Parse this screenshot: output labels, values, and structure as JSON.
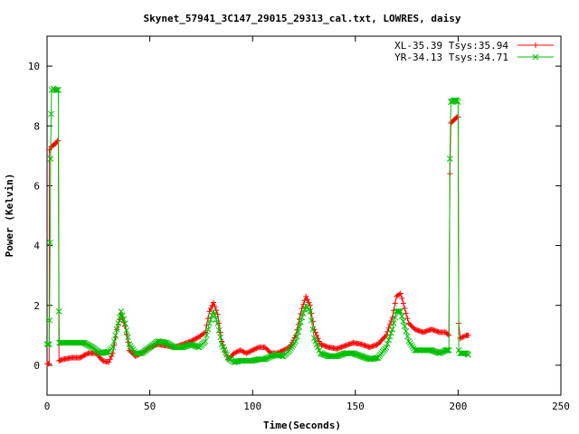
{
  "chart_data": {
    "type": "line",
    "title": "Skynet_57941_3C147_29015_29313_cal.txt, LOWRES, daisy",
    "xlabel": "Time(Seconds)",
    "ylabel": "Power (Kelvin)",
    "xlim": [
      0,
      250
    ],
    "ylim": [
      -1,
      11
    ],
    "xticks": [
      0,
      50,
      100,
      150,
      200,
      250
    ],
    "yticks": [
      0,
      2,
      4,
      6,
      8,
      10
    ],
    "grid": false,
    "legend_position": "top-right",
    "series": [
      {
        "name": "XL-35.39 Tsys:35.94",
        "color": "#ff0000",
        "marker": "plus",
        "points": [
          [
            0,
            0.05
          ],
          [
            1,
            0.05
          ],
          [
            1.2,
            7.2
          ],
          [
            2,
            7.3
          ],
          [
            3,
            7.35
          ],
          [
            4,
            7.4
          ],
          [
            5,
            7.5
          ],
          [
            5.5,
            7.5
          ],
          [
            5.8,
            0.15
          ],
          [
            8,
            0.2
          ],
          [
            12,
            0.25
          ],
          [
            16,
            0.25
          ],
          [
            20,
            0.4
          ],
          [
            24,
            0.4
          ],
          [
            27,
            0.15
          ],
          [
            30,
            0.1
          ],
          [
            32,
            0.4
          ],
          [
            34,
            1.2
          ],
          [
            36,
            1.7
          ],
          [
            38,
            1.3
          ],
          [
            40,
            0.5
          ],
          [
            43,
            0.3
          ],
          [
            46,
            0.4
          ],
          [
            50,
            0.6
          ],
          [
            54,
            0.7
          ],
          [
            58,
            0.65
          ],
          [
            62,
            0.6
          ],
          [
            66,
            0.7
          ],
          [
            70,
            0.8
          ],
          [
            74,
            0.95
          ],
          [
            77,
            1.1
          ],
          [
            79,
            1.8
          ],
          [
            81,
            2.1
          ],
          [
            83,
            1.7
          ],
          [
            85,
            0.8
          ],
          [
            88,
            0.2
          ],
          [
            91,
            0.4
          ],
          [
            94,
            0.5
          ],
          [
            97,
            0.4
          ],
          [
            100,
            0.5
          ],
          [
            103,
            0.6
          ],
          [
            106,
            0.6
          ],
          [
            109,
            0.4
          ],
          [
            112,
            0.4
          ],
          [
            115,
            0.5
          ],
          [
            118,
            0.6
          ],
          [
            121,
            1.0
          ],
          [
            124,
            1.9
          ],
          [
            126,
            2.3
          ],
          [
            128,
            2.0
          ],
          [
            130,
            1.2
          ],
          [
            133,
            0.7
          ],
          [
            137,
            0.6
          ],
          [
            141,
            0.55
          ],
          [
            145,
            0.65
          ],
          [
            149,
            0.75
          ],
          [
            153,
            0.7
          ],
          [
            157,
            0.6
          ],
          [
            161,
            0.7
          ],
          [
            165,
            1.0
          ],
          [
            168,
            1.6
          ],
          [
            170,
            2.3
          ],
          [
            172,
            2.4
          ],
          [
            174,
            1.9
          ],
          [
            176,
            1.4
          ],
          [
            179,
            1.2
          ],
          [
            183,
            1.1
          ],
          [
            187,
            1.2
          ],
          [
            191,
            1.1
          ],
          [
            194,
            1.1
          ],
          [
            195.5,
            1.0
          ],
          [
            196,
            6.4
          ],
          [
            196.5,
            8.1
          ],
          [
            198,
            8.2
          ],
          [
            199.5,
            8.3
          ],
          [
            200,
            8.3
          ],
          [
            200.3,
            1.4
          ],
          [
            201,
            0.9
          ],
          [
            204,
            1.0
          ],
          [
            205,
            1.0
          ]
        ]
      },
      {
        "name": "YR-34.13 Tsys:34.71",
        "color": "#00c000",
        "marker": "cross",
        "points": [
          [
            0,
            0.7
          ],
          [
            1,
            0.7
          ],
          [
            1.2,
            1.5
          ],
          [
            1.5,
            4.1
          ],
          [
            1.7,
            6.9
          ],
          [
            2,
            8.4
          ],
          [
            2.2,
            9.2
          ],
          [
            3,
            9.25
          ],
          [
            4,
            9.2
          ],
          [
            5,
            9.2
          ],
          [
            5.5,
            9.2
          ],
          [
            5.8,
            1.8
          ],
          [
            6,
            0.75
          ],
          [
            10,
            0.75
          ],
          [
            14,
            0.75
          ],
          [
            18,
            0.75
          ],
          [
            22,
            0.6
          ],
          [
            26,
            0.4
          ],
          [
            30,
            0.45
          ],
          [
            32,
            0.6
          ],
          [
            34,
            1.2
          ],
          [
            36,
            1.8
          ],
          [
            38,
            1.4
          ],
          [
            40,
            0.7
          ],
          [
            43,
            0.4
          ],
          [
            46,
            0.4
          ],
          [
            50,
            0.6
          ],
          [
            54,
            0.8
          ],
          [
            58,
            0.75
          ],
          [
            62,
            0.6
          ],
          [
            66,
            0.6
          ],
          [
            70,
            0.7
          ],
          [
            74,
            0.6
          ],
          [
            77,
            0.8
          ],
          [
            79,
            1.4
          ],
          [
            81,
            1.8
          ],
          [
            83,
            1.4
          ],
          [
            85,
            0.7
          ],
          [
            88,
            0.25
          ],
          [
            91,
            0.1
          ],
          [
            94,
            0.15
          ],
          [
            97,
            0.15
          ],
          [
            100,
            0.15
          ],
          [
            103,
            0.2
          ],
          [
            106,
            0.2
          ],
          [
            109,
            0.3
          ],
          [
            112,
            0.35
          ],
          [
            115,
            0.3
          ],
          [
            118,
            0.5
          ],
          [
            121,
            0.8
          ],
          [
            124,
            1.6
          ],
          [
            126,
            2.0
          ],
          [
            128,
            1.8
          ],
          [
            130,
            0.9
          ],
          [
            133,
            0.4
          ],
          [
            137,
            0.3
          ],
          [
            141,
            0.3
          ],
          [
            145,
            0.4
          ],
          [
            149,
            0.4
          ],
          [
            153,
            0.3
          ],
          [
            157,
            0.2
          ],
          [
            161,
            0.25
          ],
          [
            165,
            0.6
          ],
          [
            168,
            1.2
          ],
          [
            170,
            1.8
          ],
          [
            172,
            1.8
          ],
          [
            174,
            1.3
          ],
          [
            176,
            0.8
          ],
          [
            179,
            0.5
          ],
          [
            183,
            0.5
          ],
          [
            187,
            0.5
          ],
          [
            191,
            0.4
          ],
          [
            194,
            0.5
          ],
          [
            195.5,
            0.5
          ],
          [
            196,
            6.9
          ],
          [
            196.5,
            8.8
          ],
          [
            198,
            8.85
          ],
          [
            199.5,
            8.85
          ],
          [
            200,
            8.8
          ],
          [
            200.3,
            0.5
          ],
          [
            201,
            0.4
          ],
          [
            204,
            0.4
          ],
          [
            205,
            0.35
          ]
        ]
      }
    ]
  }
}
